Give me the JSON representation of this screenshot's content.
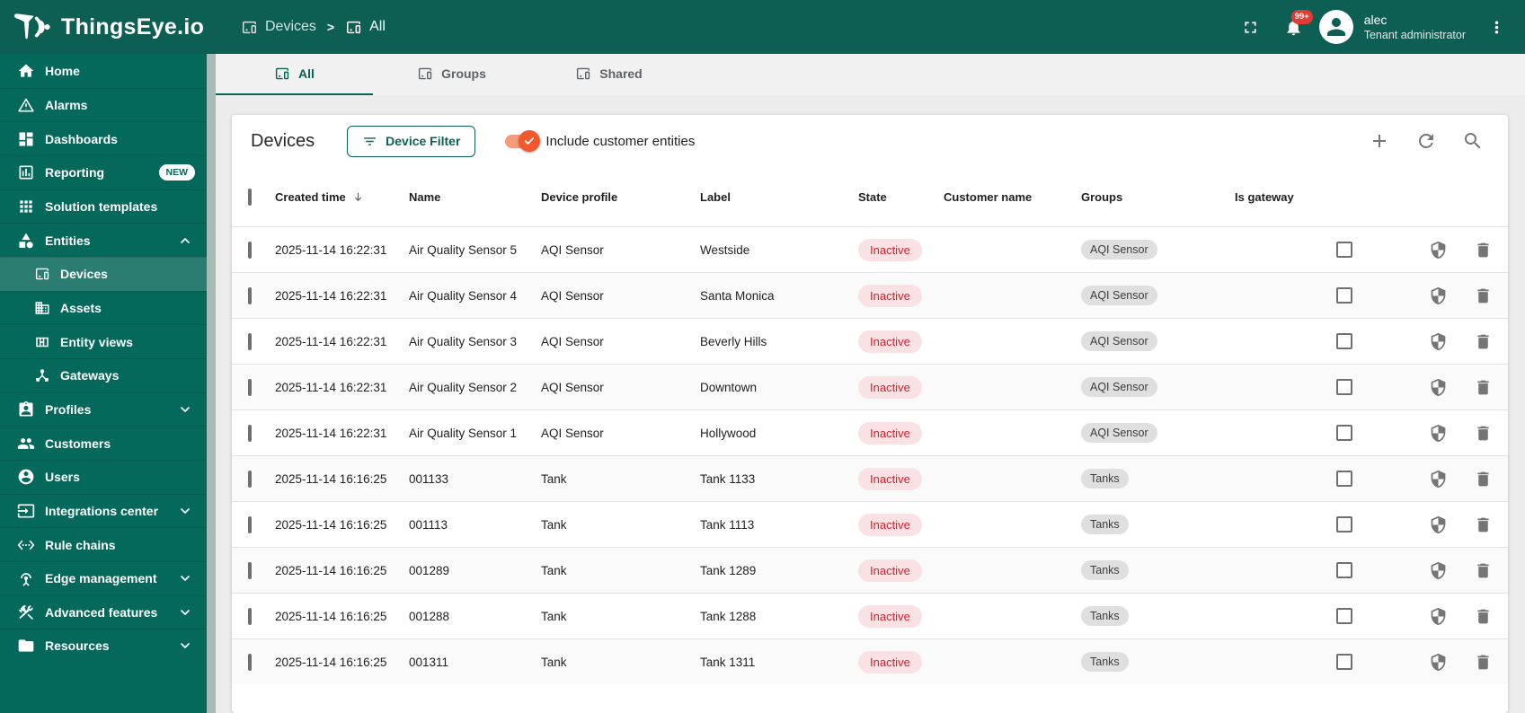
{
  "brand": {
    "name": "ThingsEye.io"
  },
  "header": {
    "breadcrumb": [
      {
        "label": "Devices",
        "icon": "devices"
      },
      {
        "label": "All",
        "icon": "devices"
      }
    ],
    "notifications_badge": "99+",
    "user": {
      "name": "alec",
      "role": "Tenant administrator"
    },
    "action_icons": [
      "fullscreen-icon",
      "bell-icon",
      "avatar-person-icon",
      "kebab-menu-icon"
    ]
  },
  "sidebar": {
    "items": [
      {
        "label": "Home",
        "icon": "home"
      },
      {
        "label": "Alarms",
        "icon": "warning"
      },
      {
        "label": "Dashboards",
        "icon": "dashboard"
      },
      {
        "label": "Reporting",
        "icon": "reporting",
        "badge": "NEW"
      },
      {
        "label": "Solution templates",
        "icon": "grid"
      },
      {
        "label": "Entities",
        "icon": "entities",
        "expandable": true,
        "expanded": true
      },
      {
        "label": "Devices",
        "icon": "devices",
        "child": true,
        "selected": true
      },
      {
        "label": "Assets",
        "icon": "assets",
        "child": true
      },
      {
        "label": "Entity views",
        "icon": "entity-views",
        "child": true
      },
      {
        "label": "Gateways",
        "icon": "gateways",
        "child": true
      },
      {
        "label": "Profiles",
        "icon": "profiles",
        "expandable": true
      },
      {
        "label": "Customers",
        "icon": "customers"
      },
      {
        "label": "Users",
        "icon": "users"
      },
      {
        "label": "Integrations center",
        "icon": "integrations",
        "expandable": true
      },
      {
        "label": "Rule chains",
        "icon": "rule-chains"
      },
      {
        "label": "Edge management",
        "icon": "edge",
        "expandable": true
      },
      {
        "label": "Advanced features",
        "icon": "advanced",
        "expandable": true
      },
      {
        "label": "Resources",
        "icon": "resources",
        "expandable": true
      }
    ]
  },
  "tabs": [
    {
      "label": "All",
      "icon": "devices",
      "active": true
    },
    {
      "label": "Groups",
      "icon": "devices",
      "active": false
    },
    {
      "label": "Shared",
      "icon": "devices",
      "active": false
    }
  ],
  "panel": {
    "title": "Devices",
    "filter_button": "Device Filter",
    "toggle_label": "Include customer entities",
    "toggle_on": true,
    "tool_icons": [
      "plus-icon",
      "refresh-icon",
      "search-icon"
    ]
  },
  "table": {
    "columns": [
      "Created time",
      "Name",
      "Device profile",
      "Label",
      "State",
      "Customer name",
      "Groups",
      "Is gateway"
    ],
    "sorted_by": "Created time",
    "sort_direction": "desc",
    "row_action_icons": [
      "shield-icon",
      "delete-icon"
    ],
    "rows": [
      {
        "created": "2025-11-14 16:22:31",
        "name": "Air Quality Sensor 5",
        "profile": "AQI Sensor",
        "label": "Westside",
        "state": "Inactive",
        "customer": "",
        "groups": [
          "AQI Sensor"
        ],
        "is_gateway": false
      },
      {
        "created": "2025-11-14 16:22:31",
        "name": "Air Quality Sensor 4",
        "profile": "AQI Sensor",
        "label": "Santa Monica",
        "state": "Inactive",
        "customer": "",
        "groups": [
          "AQI Sensor"
        ],
        "is_gateway": false
      },
      {
        "created": "2025-11-14 16:22:31",
        "name": "Air Quality Sensor 3",
        "profile": "AQI Sensor",
        "label": "Beverly Hills",
        "state": "Inactive",
        "customer": "",
        "groups": [
          "AQI Sensor"
        ],
        "is_gateway": false
      },
      {
        "created": "2025-11-14 16:22:31",
        "name": "Air Quality Sensor 2",
        "profile": "AQI Sensor",
        "label": "Downtown",
        "state": "Inactive",
        "customer": "",
        "groups": [
          "AQI Sensor"
        ],
        "is_gateway": false
      },
      {
        "created": "2025-11-14 16:22:31",
        "name": "Air Quality Sensor 1",
        "profile": "AQI Sensor",
        "label": "Hollywood",
        "state": "Inactive",
        "customer": "",
        "groups": [
          "AQI Sensor"
        ],
        "is_gateway": false
      },
      {
        "created": "2025-11-14 16:16:25",
        "name": "001133",
        "profile": "Tank",
        "label": "Tank 1133",
        "state": "Inactive",
        "customer": "",
        "groups": [
          "Tanks"
        ],
        "is_gateway": false
      },
      {
        "created": "2025-11-14 16:16:25",
        "name": "001113",
        "profile": "Tank",
        "label": "Tank 1113",
        "state": "Inactive",
        "customer": "",
        "groups": [
          "Tanks"
        ],
        "is_gateway": false
      },
      {
        "created": "2025-11-14 16:16:25",
        "name": "001289",
        "profile": "Tank",
        "label": "Tank 1289",
        "state": "Inactive",
        "customer": "",
        "groups": [
          "Tanks"
        ],
        "is_gateway": false
      },
      {
        "created": "2025-11-14 16:16:25",
        "name": "001288",
        "profile": "Tank",
        "label": "Tank 1288",
        "state": "Inactive",
        "customer": "",
        "groups": [
          "Tanks"
        ],
        "is_gateway": false
      },
      {
        "created": "2025-11-14 16:16:25",
        "name": "001311",
        "profile": "Tank",
        "label": "Tank 1311",
        "state": "Inactive",
        "customer": "",
        "groups": [
          "Tanks"
        ],
        "is_gateway": false
      }
    ]
  },
  "colors": {
    "topbar": "#0D5F54",
    "sidebar": "#04695B",
    "sidebar_selected": "#2B7D71",
    "accent_teal": "#0A6156",
    "toggle_orange": "#F1582B",
    "toggle_track": "#F59A7B",
    "notification_red": "#E23B34",
    "state_inactive_bg": "#F9E1E4",
    "state_inactive_text": "#D4212F",
    "group_pill_bg": "#DFDFDF"
  }
}
